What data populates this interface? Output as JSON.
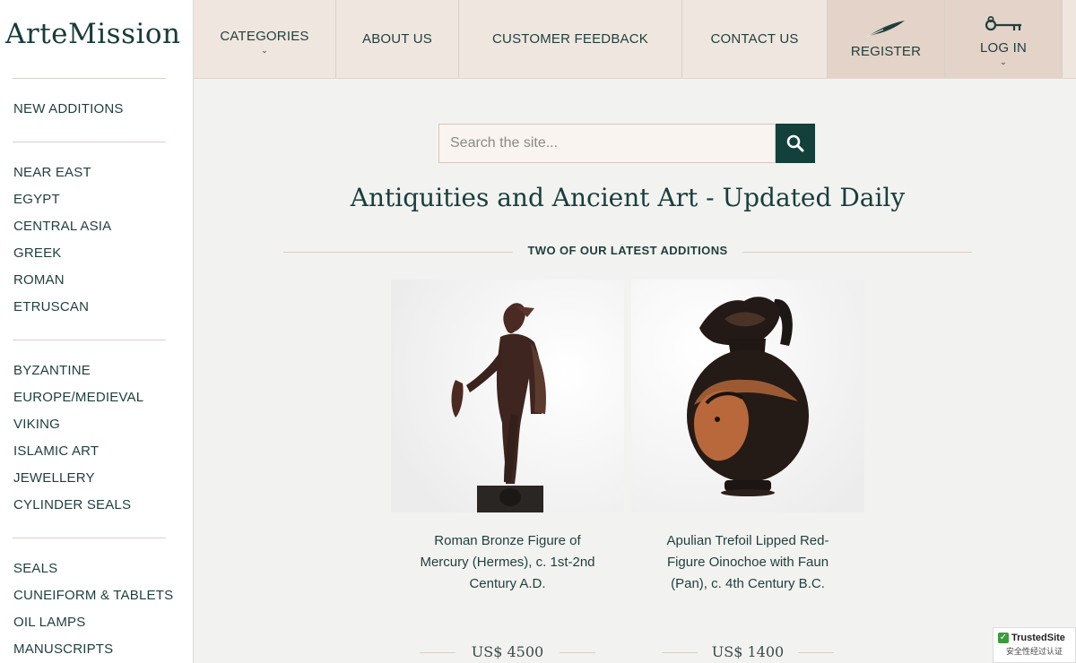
{
  "brand": {
    "logo": "ArteMission"
  },
  "sidebar": {
    "groups": [
      [
        "NEW ADDITIONS"
      ],
      [
        "NEAR EAST",
        "EGYPT",
        "CENTRAL ASIA",
        "GREEK",
        "ROMAN",
        "ETRUSCAN"
      ],
      [
        "BYZANTINE",
        "EUROPE/MEDIEVAL",
        "VIKING",
        "ISLAMIC ART",
        "JEWELLERY",
        "CYLINDER SEALS"
      ],
      [
        "SEALS",
        "CUNEIFORM & TABLETS",
        "OIL LAMPS",
        "MANUSCRIPTS"
      ]
    ]
  },
  "nav": {
    "categories": "CATEGORIES",
    "about": "ABOUT US",
    "feedback": "CUSTOMER FEEDBACK",
    "contact": "CONTACT US",
    "register": "REGISTER",
    "login": "LOG IN"
  },
  "search": {
    "placeholder": "Search the site..."
  },
  "main": {
    "headline": "Antiquities and Ancient Art - Updated Daily",
    "section_label": "TWO OF OUR LATEST ADDITIONS",
    "products": [
      {
        "title": "Roman Bronze Figure of Mercury (Hermes), c. 1st-2nd Century A.D.",
        "price": "US$ 4500"
      },
      {
        "title": "Apulian Trefoil Lipped Red-Figure Oinochoe with Faun (Pan), c. 4th Century B.C.",
        "price": "US$ 1400"
      }
    ]
  },
  "badge": {
    "name": "TrustedSite",
    "subtitle": "安全性经过认证"
  },
  "colors": {
    "accent": "#14403c",
    "nav_bg": "#efe6df",
    "nav_accent": "#e3d3c8",
    "page_bg": "#f2f2f1"
  }
}
